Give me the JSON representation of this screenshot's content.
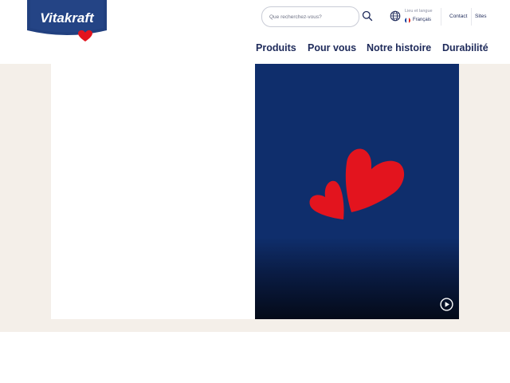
{
  "brand": {
    "name": "Vitakraft",
    "logo_colors": {
      "shield": "#21407f",
      "heart": "#e3141e"
    }
  },
  "search": {
    "placeholder": "Que recherchez-vous?",
    "icon": "search-icon"
  },
  "language": {
    "title": "Lieu et langue",
    "current": "Français",
    "icon": "globe-icon",
    "flag_colors": [
      "#0b3a9c",
      "#ffffff",
      "#e1241b"
    ]
  },
  "top_links": {
    "contact": "Contact",
    "sites": "Sites"
  },
  "nav": {
    "items": [
      "Produits",
      "Pour vous",
      "Notre histoire",
      "Durabilité"
    ]
  },
  "hero": {
    "background": "#0f2e6c",
    "heart_color": "#e3141e",
    "play_icon": "play-circle-icon"
  },
  "colors": {
    "text_dark": "#1e2a5a",
    "band": "#f4efe9"
  }
}
